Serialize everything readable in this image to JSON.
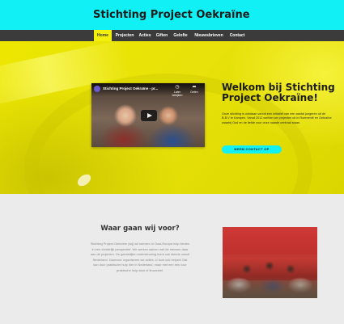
{
  "header": {
    "title": "Stichting Project Oekraïne",
    "accent_color": "#10f0f5"
  },
  "nav": {
    "items": [
      {
        "label": "Home",
        "active": true
      },
      {
        "label": "Projecten",
        "active": false
      },
      {
        "label": "Acties",
        "active": false
      },
      {
        "label": "Giften",
        "active": false
      },
      {
        "label": "Gelofte",
        "active": false
      },
      {
        "label": "Nieuwsbrieven",
        "active": false
      },
      {
        "label": "Contact",
        "active": false
      }
    ],
    "active_color": "#f4ee0c"
  },
  "hero": {
    "video": {
      "title": "Stichting Project Oekraïne - pr...",
      "later_label": "Later bekijken",
      "later_icon": "clock-icon",
      "share_label": "Delen",
      "share_icon": "share-icon",
      "play_icon": "youtube-play-icon"
    },
    "heading": "Welkom bij Stichting Project Oekraïne!",
    "text": "Onze stichting is ontstaan vanuit een initiatief van een aantal jongeren uit de B.B.V te Kampen. Vanaf 2012 werken we projecten uit in Roemenië en Oekraïne waarbij God en de liefde voor onze naaste centraal staan.",
    "button_label": "NEEM CONTACT OP"
  },
  "about": {
    "heading": "Waar gaan wij voor?",
    "text": "Stichting Project Oekraïne (wij) wil mensen in Oost-Europa hulp bieden in een christelijk perspectief. We werken samen met de mensen daar aan de projecten. De geestelijke ondersteuning komt ook steeds vanuit Nederland. Daarvoor organiseren we acties. U kunt ook helpen! Dat kan door praktische hulp hier in Nederland, maar met een reis voor praktische hulp daar of financieel."
  }
}
